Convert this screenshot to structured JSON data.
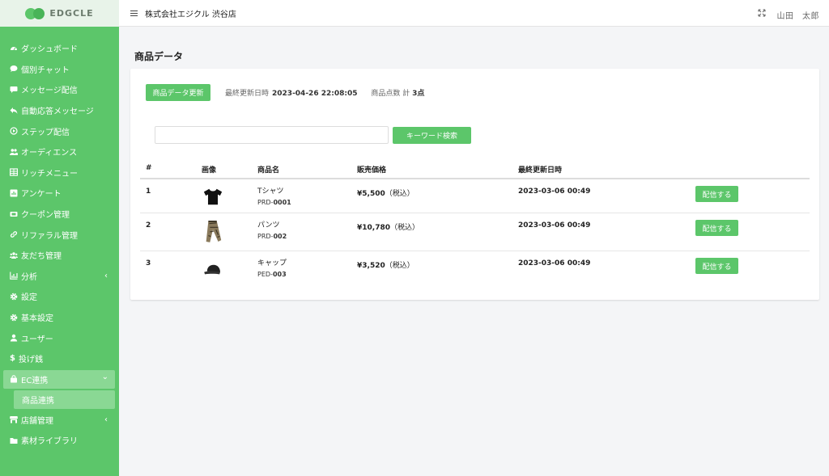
{
  "brand": {
    "logo_text": "EDGCLE",
    "accent": "#5cc66a"
  },
  "sidebar": {
    "items": [
      {
        "label": "ダッシュボード",
        "icon": "dashboard-icon"
      },
      {
        "label": "個別チャット",
        "icon": "chat-bubble-icon"
      },
      {
        "label": "メッセージ配信",
        "icon": "message-icon"
      },
      {
        "label": "自動応答メッセージ",
        "icon": "reply-icon"
      },
      {
        "label": "ステップ配信",
        "icon": "play-circle-icon"
      },
      {
        "label": "オーディエンス",
        "icon": "users-icon"
      },
      {
        "label": "リッチメニュー",
        "icon": "table-icon"
      },
      {
        "label": "アンケート",
        "icon": "poll-icon"
      },
      {
        "label": "クーポン管理",
        "icon": "ticket-icon"
      },
      {
        "label": "リファラル管理",
        "icon": "link-icon"
      },
      {
        "label": "友だち管理",
        "icon": "friends-icon"
      },
      {
        "label": "分析",
        "icon": "chart-icon",
        "arrow": "‹"
      },
      {
        "label": "設定",
        "icon": "gear-icon"
      },
      {
        "label": "基本設定",
        "icon": "gear-icon"
      },
      {
        "label": "ユーザー",
        "icon": "user-icon"
      },
      {
        "label": "投げ銭",
        "icon": "dollar-icon"
      },
      {
        "label": "EC連携",
        "icon": "bag-icon",
        "arrow": "⌄"
      },
      {
        "label": "商品連携"
      },
      {
        "label": "店舗管理",
        "icon": "store-icon",
        "arrow": "‹"
      },
      {
        "label": "素材ライブラリ",
        "icon": "folder-icon"
      }
    ]
  },
  "topbar": {
    "store_name": "株式会社エジクル 渋谷店",
    "user_name": "山田　太郎"
  },
  "page": {
    "title": "商品データ"
  },
  "toolbar": {
    "update_label": "商品データ更新",
    "last_updated_label": "最終更新日時",
    "last_updated_value": "2023-04-26 22:08:05",
    "count_label": "商品点数 計 ",
    "count_value": "3",
    "count_unit": "点"
  },
  "search": {
    "placeholder": "",
    "value": "",
    "button_label": "キーワード検索"
  },
  "table": {
    "headers": {
      "num": "#",
      "image": "画像",
      "name": "商品名",
      "price": "販売価格",
      "updated": "最終更新日時"
    },
    "rows": [
      {
        "num": "1",
        "image": "tshirt-icon",
        "name": "Tシャツ",
        "code_prefix": "PRD-",
        "code": "0001",
        "price": "¥5,500",
        "tax": "（税込）",
        "updated": "2023-03-06 00:49",
        "action": "配信する"
      },
      {
        "num": "2",
        "image": "pants-icon",
        "name": "パンツ",
        "code_prefix": "PRD-",
        "code": "002",
        "price": "¥10,780",
        "tax": "（税込）",
        "updated": "2023-03-06 00:49",
        "action": "配信する"
      },
      {
        "num": "3",
        "image": "cap-icon",
        "name": "キャップ",
        "code_prefix": "PED-",
        "code": "003",
        "price": "¥3,520",
        "tax": "（税込）",
        "updated": "2023-03-06 00:49",
        "action": "配信する"
      }
    ]
  }
}
